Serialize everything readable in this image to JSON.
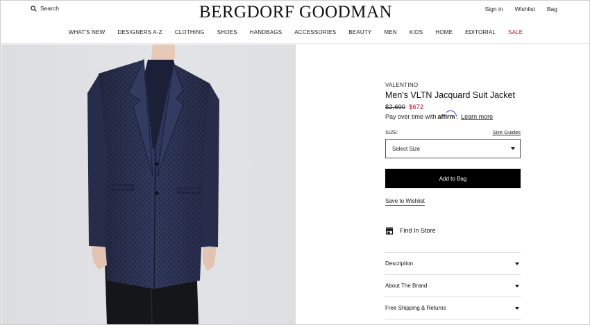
{
  "header": {
    "search_label": "Search",
    "logo_text": "BERGDORF GOODMAN",
    "account": {
      "sign_in": "Sign in",
      "wishlist": "Wishlist",
      "bag": "Bag"
    }
  },
  "nav": {
    "items": [
      "WHAT'S NEW",
      "DESIGNERS A-Z",
      "CLOTHING",
      "SHOES",
      "HANDBAGS",
      "ACCESSORIES",
      "BEAUTY",
      "MEN",
      "KIDS",
      "HOME",
      "EDITORIAL",
      "SALE"
    ]
  },
  "product": {
    "brand": "VALENTINO",
    "name": "Men's VLTN Jacquard Suit Jacket",
    "original_price": "$2,690",
    "sale_price": "$672",
    "affirm": {
      "prefix": "Pay over time with",
      "brand": "affirm",
      "suffix": ".",
      "learn_more": "Learn more"
    },
    "size_label": "SIZE:",
    "size_guides": "Size Guides",
    "size_select": "Select Size",
    "add_to_bag": "Add to Bag",
    "save_to_wishlist": "Save to Wishlist",
    "find_in_store": "Find In Store",
    "accordion": [
      "Description",
      "About The Brand",
      "Free Shipping & Returns"
    ]
  },
  "colors": {
    "sale": "#b0172c",
    "button_bg": "#000000",
    "jacket": "#2a3152",
    "affirm_arc": "#4a4af4"
  }
}
